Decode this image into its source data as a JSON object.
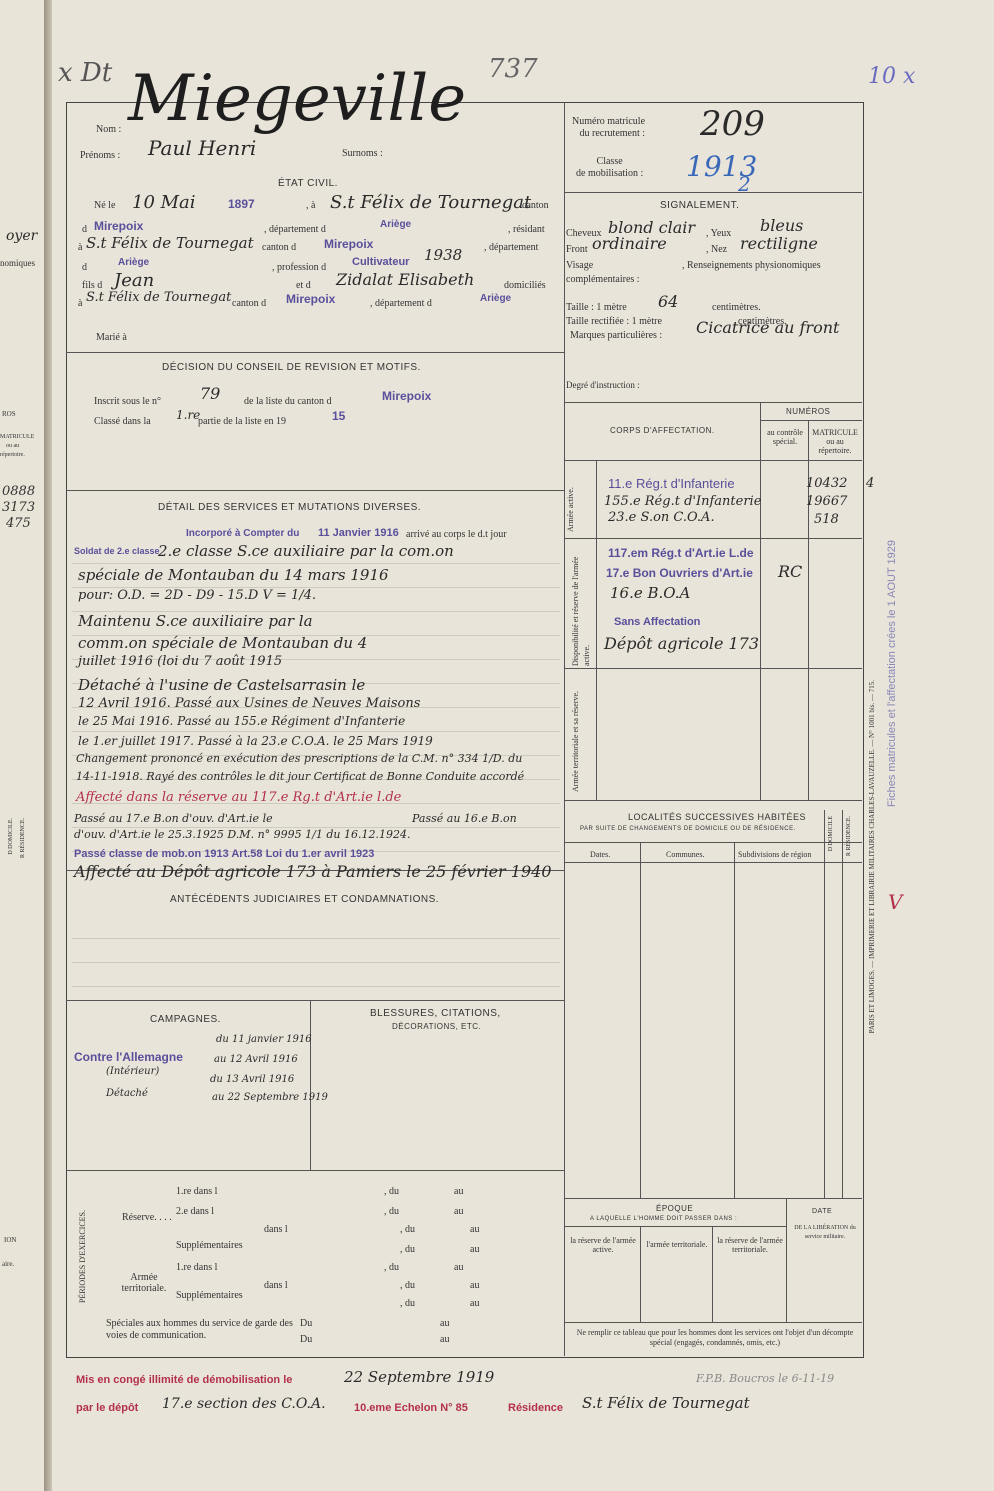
{
  "margin_marks": {
    "top_left": "x Dt",
    "top_right": "10 x",
    "ref": "737",
    "number": "209"
  },
  "left_page": {
    "frag1": "oyer",
    "frag2": "nomiques",
    "frag3": "ROS",
    "frag4": "MATRICULE",
    "frag5": "ou au",
    "frag6": "répertoire.",
    "n1": "0888",
    "n2": "3173",
    "n3": "475",
    "frag7": "D DOMICILE.",
    "frag8": "R RÉSIDENCE.",
    "frag9": "ION",
    "frag10": "aire."
  },
  "header": {
    "nom_label": "Nom :",
    "nom": "Miegeville",
    "prenoms_label": "Prénoms :",
    "prenoms": "Paul Henri",
    "surnoms_label": "Surnoms :",
    "matricule_label": "Numéro matricule\ndu recrutement :",
    "matricule": "209",
    "classe_label": "Classe\nde mobilisation :",
    "classe": "1913",
    "classe_mark": "2"
  },
  "etat_civil": {
    "title": "ÉTAT CIVIL.",
    "ne_le": "Né le",
    "date": "10 Mai",
    "annee": "1897",
    "a": ", à",
    "lieu": "S.t Félix de Tournegat",
    "canton": "canton",
    "d": "d",
    "canton_name": "Mirepoix",
    "departement_d": ", département d",
    "dept": "Ariège",
    "resident": ", résidant",
    "a2": "à",
    "residence": "S.t Félix de Tournegat",
    "canton_d": "canton d",
    "canton2": "Mirepoix",
    "departement": ", département",
    "d2": "d",
    "dept2": "Ariège",
    "profession_label": ", profession d",
    "profession": "Cultivateur",
    "profession_year": "1938",
    "fils_de": "fils d",
    "pere": "Jean",
    "et_de": "et d",
    "mere": "Zidalat Elisabeth",
    "domicilies": "domiciliés",
    "a3": "à",
    "domicile": "S.t Félix de Tournegat",
    "canton_d2": "canton d",
    "canton3": "Mirepoix",
    "departement_d2": ", département d",
    "dept3": "Ariège",
    "marie": "Marié à"
  },
  "signalement": {
    "title": "SIGNALEMENT.",
    "cheveux_label": "Cheveux",
    "cheveux": "blond clair",
    "yeux_label": ", Yeux",
    "yeux": "bleus",
    "front_label": "Front",
    "front": "ordinaire",
    "nez_label": ", Nez",
    "nez": "rectiligne",
    "visage_label": "Visage",
    "renseignements": ", Renseignements physionomiques",
    "complementaires": "complémentaires :",
    "taille_label": "Taille : 1 mètre",
    "taille": "64",
    "centimetres": "centimètres.",
    "taille_rect": "Taille rectifiée : 1 mètre",
    "centimetres2": "centimètres.",
    "marques_label": "Marques particulières :",
    "marques": "Cicatrice au front",
    "degre": "Degré d'instruction :"
  },
  "decision": {
    "title": "DÉCISION DU CONSEIL DE REVISION ET MOTIFS.",
    "inscrit": "Inscrit sous le n°",
    "num": "79",
    "liste": "de la liste du canton d",
    "canton": "Mirepoix",
    "classe_dans": "Classé dans la",
    "partie": "1.re",
    "partie_txt": "partie de la liste en 19",
    "annee": "15"
  },
  "corps": {
    "title": "CORPS D'AFFECTATION.",
    "numeros": "NUMÉROS",
    "au_controle": "au contrôle spécial.",
    "matricule": "MATRICULE ou au répertoire.",
    "armee_active": "Armée active.",
    "disponibilite": "Disponibilité et réserve de l'armée active.",
    "territoriale": "Armée territoriale et sa réserve.",
    "a1": "11.e Rég.t d'Infanterie",
    "a2": "155.e Rég.t d'Infanterie",
    "a3": "23.e S.on C.O.A.",
    "n1": "10432",
    "n1b": "4",
    "n2": "19667",
    "n3": "518",
    "d1": "117.em Rég.t d'Art.ie L.de",
    "d2": "17.e Bon Ouvriers d'Art.ie",
    "d3": "16.e B.O.A",
    "rc": "RC",
    "t0": "Sans Affectation",
    "t1": "Dépôt agricole 173"
  },
  "services": {
    "title": "DÉTAIL DES SERVICES ET MUTATIONS DIVERSES.",
    "incorpore": "Incorporé à Compter du",
    "date_inc": "11 Janvier 1916",
    "arrive": "arrivé au corps le d.t jour",
    "soldat": "Soldat de 2.e classe",
    "lines": [
      "2.e classe S.ce auxiliaire par la com.on",
      "spéciale de Montauban du 14 mars 1916",
      "pour: O.D. = 2D - D9 - 15.D V = 1/4.",
      "Maintenu S.ce auxiliaire par la",
      "comm.on spéciale de Montauban du 4",
      "juillet 1916 (loi du 7 août 1915",
      "Détaché à l'usine de Castelsarrasin le",
      "12 Avril 1916. Passé aux Usines de Neuves Maisons",
      "le 25 Mai 1916. Passé au 155.e Régiment d'Infanterie",
      "le 1.er juillet 1917. Passé à la 23.e C.O.A. le 25 Mars 1919",
      "Changement prononcé en exécution des prescriptions de la C.M. n° 334 1/D. du",
      "14-11-1918. Rayé des contrôles le dit jour Certificat de Bonne Conduite accordé",
      "Affecté dans la réserve au 117.e Rg.t d'Art.ie l.de",
      "Passé au 17.e B.on d'ouv. d'Art.ie le",
      "Passé au 16.e B.on",
      "d'ouv. d'Art.ie le 25.3.1925 D.M. n° 9995 1/1 du 16.12.1924.",
      "Passé classe de mob.on 1913 Art.58 Loi du 1.er avril 1923",
      "Affecté au Dépôt agricole 173 à Pamiers le 25 février 1940"
    ]
  },
  "antecedents": {
    "title": "ANTÉCÉDENTS JUDICIAIRES ET CONDAMNATIONS."
  },
  "localites": {
    "title": "LOCALITÉS SUCCESSIVES HABITÉES",
    "subtitle": "PAR SUITE DE CHANGEMENTS DE DOMICILE OU DE RÉSIDENCE.",
    "dates": "Dates.",
    "communes": "Communes.",
    "subdivisions": "Subdivisions de région",
    "domicile": "D DOMICILE",
    "residence": "R RÉSIDENCE."
  },
  "campagnes": {
    "title": "CAMPAGNES.",
    "contre": "Contre l'Allemagne",
    "interieur": "(Intérieur)",
    "detache": "Détaché",
    "l1": "du 11 janvier 1916",
    "l2": "au 12 Avril 1916",
    "l3": "du 13 Avril 1916",
    "l4": "au 22 Septembre 1919"
  },
  "blessures": {
    "title": "BLESSURES, CITATIONS,",
    "subtitle": "DÉCORATIONS, ETC."
  },
  "exercices": {
    "side": "PÉRIODES D'EXERCICES.",
    "reserve": "Réserve. . . .",
    "territoriale": "Armée territoriale.",
    "dans1": "1.re dans l",
    "dans2": "2.e dans l",
    "supplementaires": "Supplémentaires",
    "dans": "dans l",
    "du": ", du",
    "au": "au",
    "speciales": "Spéciales aux hommes du service de garde des voies de communication.",
    "Du": "Du"
  },
  "epoque": {
    "title": "ÉPOQUE",
    "sub": "A LAQUELLE L'HOMME DOIT PASSER DANS :",
    "c1": "la réserve de l'armée active.",
    "c2": "l'armée territoriale.",
    "c3": "la réserve de l'armée territoriale.",
    "date": "DATE",
    "date2": "DE LA LIBÉRATION du service militaire.",
    "note": "Ne remplir ce tableau que pour les hommes dont les services ont l'objet d'un décompte spécial (engagés, condamnés, omis, etc.)"
  },
  "side_text": {
    "printer": "PARIS ET LIMOGES. — IMPRIMERIE ET LIBRAIRIE MILITAIRES CHARLES-LAVAUZELLE. — N° 1001 bis. — 715.",
    "stamp": "Fiches matricules et l'affectation crées le 1 AOUT 1929",
    "mark": "V"
  },
  "footer": {
    "line1": "Mis en congé illimité de démobilisation le",
    "date1": "22 Septembre 1919",
    "note": "F.P.B. Boucros le 6-11-19",
    "line2": "par le dépôt",
    "depot": "17.e section des C.O.A.",
    "echelon": "10.eme Echelon N° 85",
    "residence_label": "Résidence",
    "residence": "S.t Félix de Tournegat"
  }
}
